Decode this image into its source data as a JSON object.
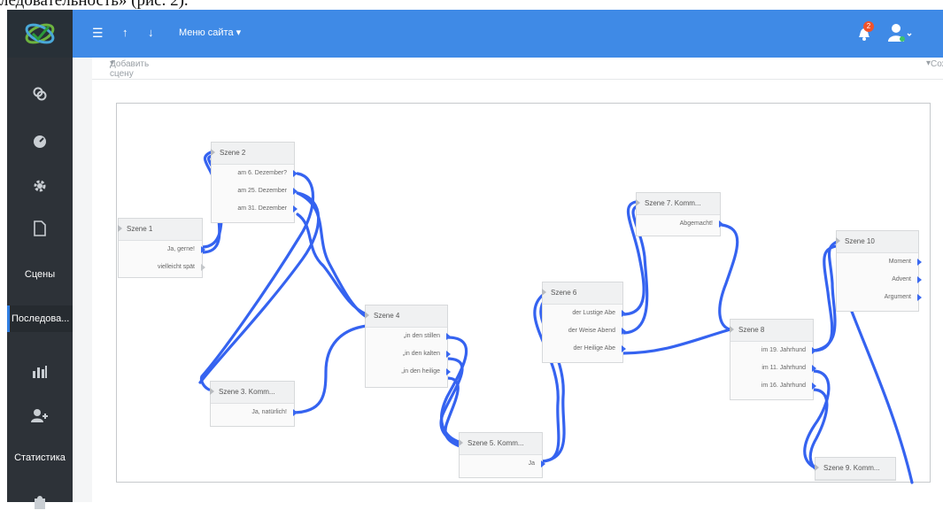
{
  "doc_caption": "ледовательность» (рис. 2).",
  "topbar": {
    "menu_icon": "hamburger-icon",
    "up_icon": "arrow-up-icon",
    "down_icon": "arrow-down-icon",
    "site_menu_label": "Меню сайта",
    "notification_count": "2",
    "accent_color": "#3f8ae6"
  },
  "sidebar": {
    "background": "#2d3238",
    "items": [
      {
        "icon": "link-icon",
        "label": ""
      },
      {
        "icon": "dashboard-icon",
        "label": ""
      },
      {
        "icon": "gear-icon",
        "label": ""
      },
      {
        "icon": "file-icon",
        "label": ""
      },
      {
        "icon": "",
        "label": "Сцены"
      },
      {
        "icon": "",
        "label": "Последова..."
      },
      {
        "icon": "bar-chart-icon",
        "label": ""
      },
      {
        "icon": "add-user-icon",
        "label": ""
      },
      {
        "icon": "",
        "label": "Статистика"
      },
      {
        "icon": "puzzle-icon",
        "label": ""
      }
    ]
  },
  "subbar": {
    "add_scene_label": "Добавить сцену",
    "save_label": "Сохранить"
  },
  "nodes": [
    {
      "title": "Szene 1",
      "options": [
        "Ja, gerne!",
        "vielleicht spät"
      ]
    },
    {
      "title": "Szene 2",
      "options": [
        "am 6. Dezember?",
        "am 25. Dezember",
        "am 31. Dezember"
      ]
    },
    {
      "title": "Szene 3. Komm...",
      "options": [
        "Ja, natürlich!"
      ]
    },
    {
      "title": "Szene 4",
      "options": [
        "„in den stillen",
        "„in den kalten",
        "„in den heilige"
      ]
    },
    {
      "title": "Szene 5. Komm...",
      "options": [
        "Ja"
      ]
    },
    {
      "title": "Szene 6",
      "options": [
        "der Lustige Abe",
        "der Weise Abend",
        "der Heilige Abe"
      ]
    },
    {
      "title": "Szene 7. Komm...",
      "options": [
        "Abgemacht!"
      ]
    },
    {
      "title": "Szene 8",
      "options": [
        "im 19. Jahrhund",
        "im 11. Jahrhund",
        "im 16. Jahrhund"
      ]
    },
    {
      "title": "Szene 9. Komm...",
      "options": []
    },
    {
      "title": "Szene 10",
      "options": [
        "Moment",
        "Advent",
        "Argument"
      ]
    }
  ]
}
